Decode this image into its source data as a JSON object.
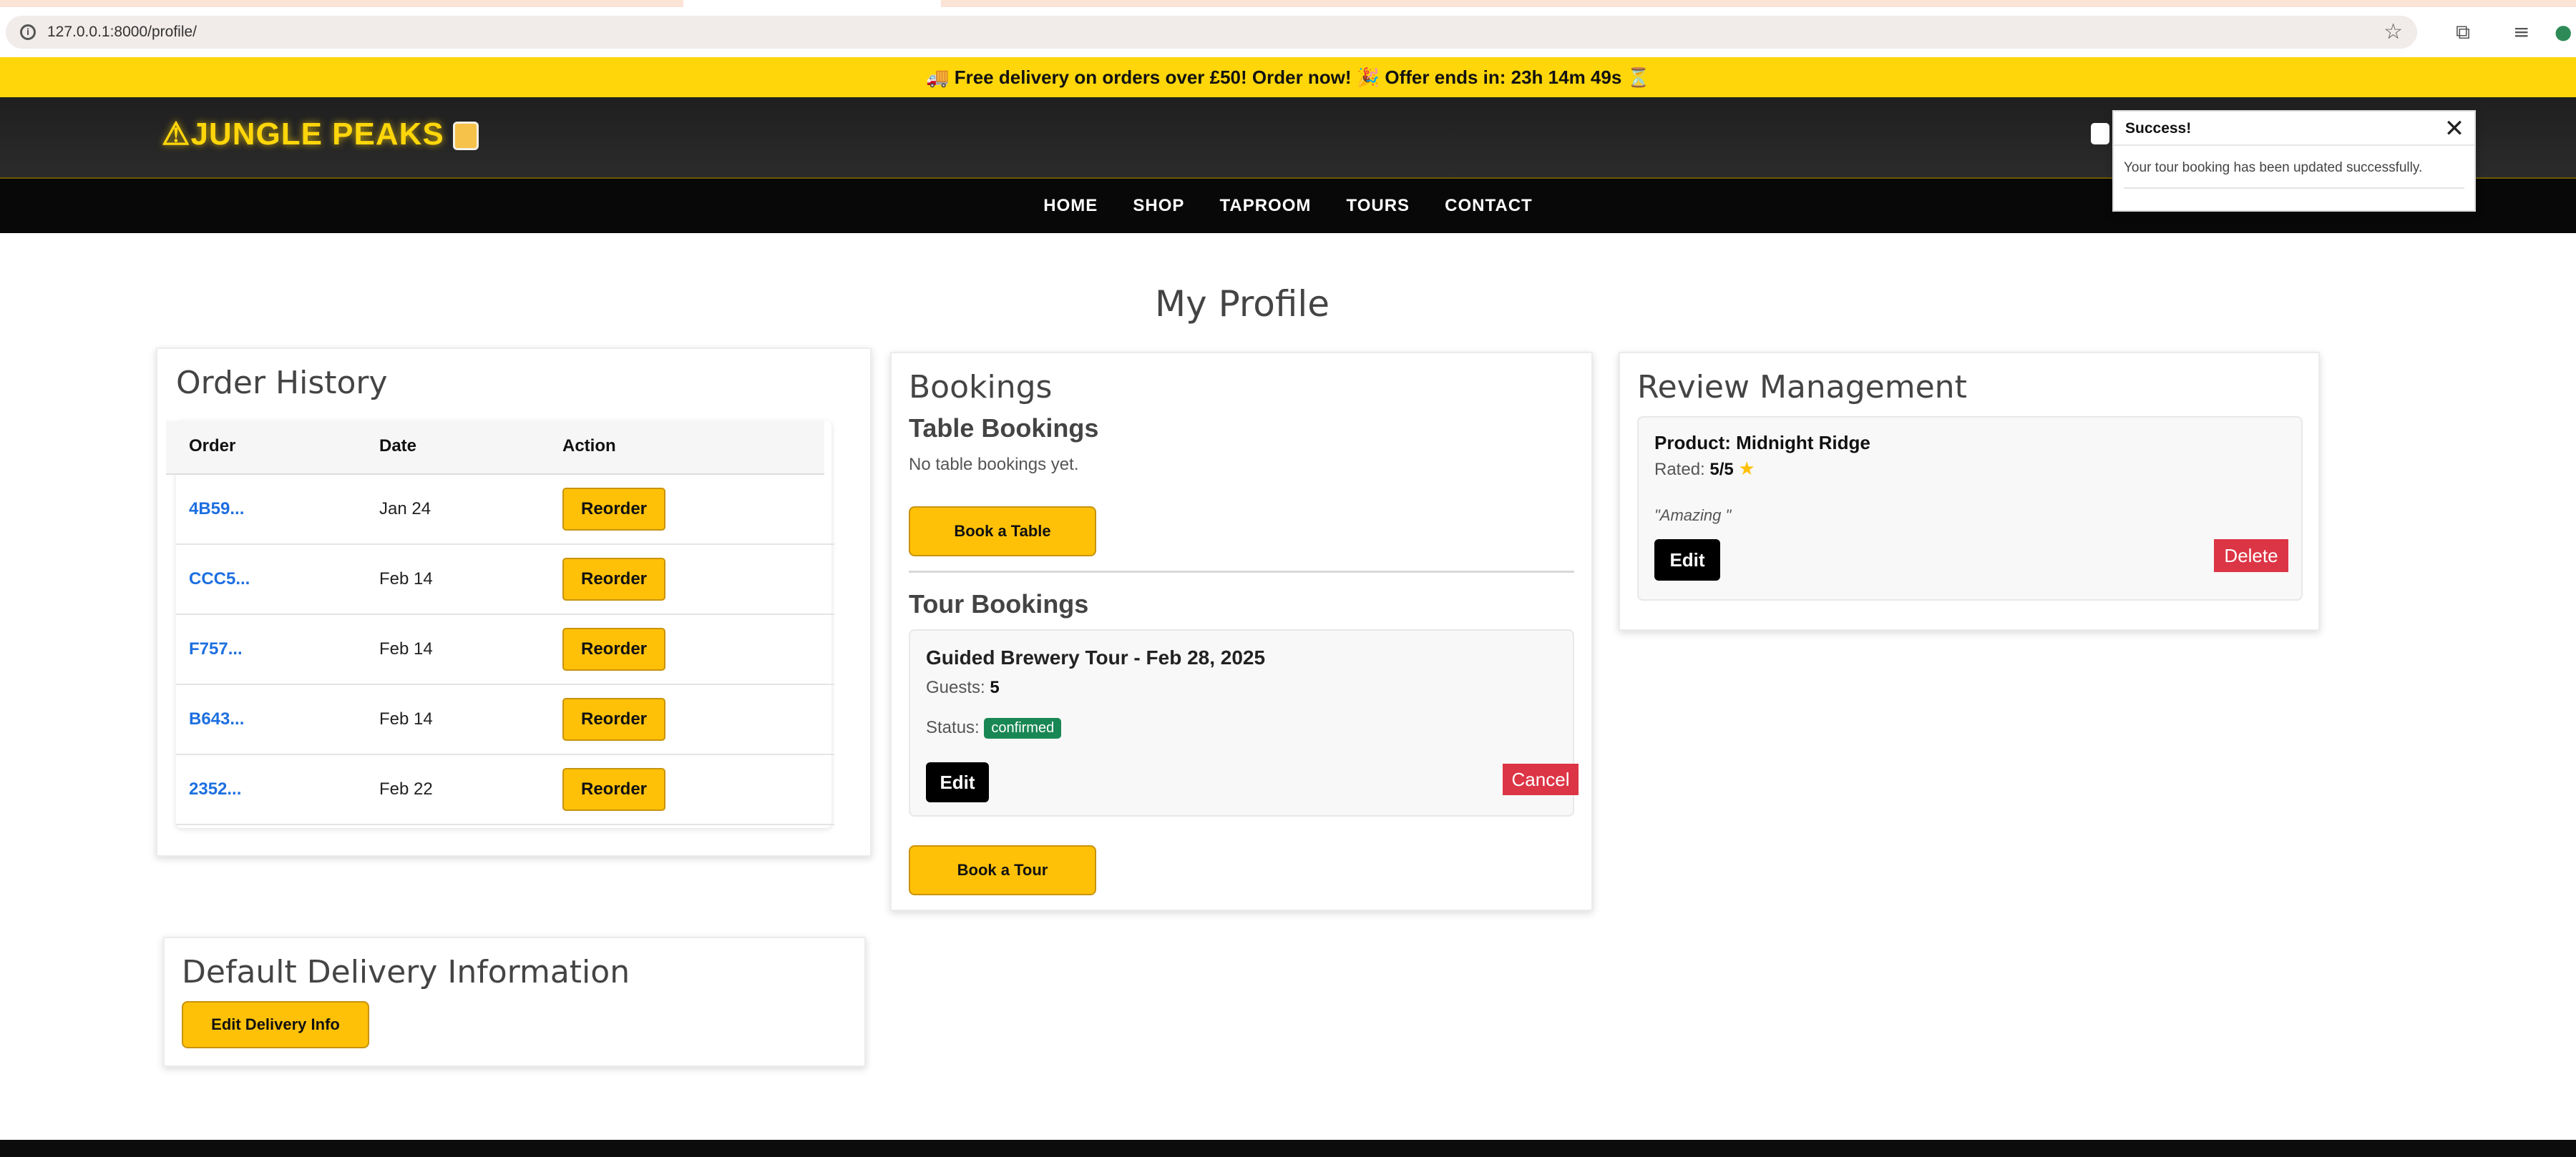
{
  "browser": {
    "url": "127.0.0.1:8000/profile/"
  },
  "promo": {
    "text": "🚚 Free delivery on orders over £50! Order now! 🎉 Offer ends in: 23h 14m 49s ⏳"
  },
  "header": {
    "brand": "⚠JUNGLE PEAKS"
  },
  "nav": {
    "items": [
      "HOME",
      "SHOP",
      "TAPROOM",
      "TOURS",
      "CONTACT"
    ]
  },
  "toast": {
    "title": "Success!",
    "close": "✕",
    "message": "Your tour booking has been updated successfully."
  },
  "page": {
    "title": "My Profile"
  },
  "orders": {
    "title": "Order History",
    "headers": [
      "Order",
      "Date",
      "Action"
    ],
    "rows": [
      {
        "id": "4B59...",
        "date": "Jan 24",
        "action": "Reorder"
      },
      {
        "id": "CCC5...",
        "date": "Feb 14",
        "action": "Reorder"
      },
      {
        "id": "F757...",
        "date": "Feb 14",
        "action": "Reorder"
      },
      {
        "id": "B643...",
        "date": "Feb 14",
        "action": "Reorder"
      },
      {
        "id": "2352...",
        "date": "Feb 22",
        "action": "Reorder"
      }
    ]
  },
  "bookings": {
    "title": "Bookings",
    "table_title": "Table Bookings",
    "no_table": "No table bookings yet.",
    "book_table": "Book a Table",
    "tour_title": "Tour Bookings",
    "tour_name": "Guided Brewery Tour - Feb 28, 2025",
    "guests_label": "Guests:",
    "guests_value": "5",
    "status_label": "Status:",
    "status_value": "confirmed",
    "edit": "Edit",
    "cancel": "Cancel",
    "book_tour": "Book a Tour"
  },
  "reviews": {
    "title": "Review Management",
    "product_label": "Product:",
    "product_value": "Midnight Ridge",
    "rated_label": "Rated:",
    "rated_value": "5/5",
    "rating_icon": "star-icon",
    "comment": "\"Amazing \"",
    "edit": "Edit",
    "delete": "Delete"
  },
  "delivery": {
    "title": "Default Delivery Information",
    "button": "Edit Delivery Info"
  },
  "colors": {
    "accent_yellow": "#ffd60a",
    "button_yellow": "#ffc107",
    "link_blue": "#1d6fe0",
    "success_green": "#198754",
    "danger_red": "#dc3545"
  }
}
